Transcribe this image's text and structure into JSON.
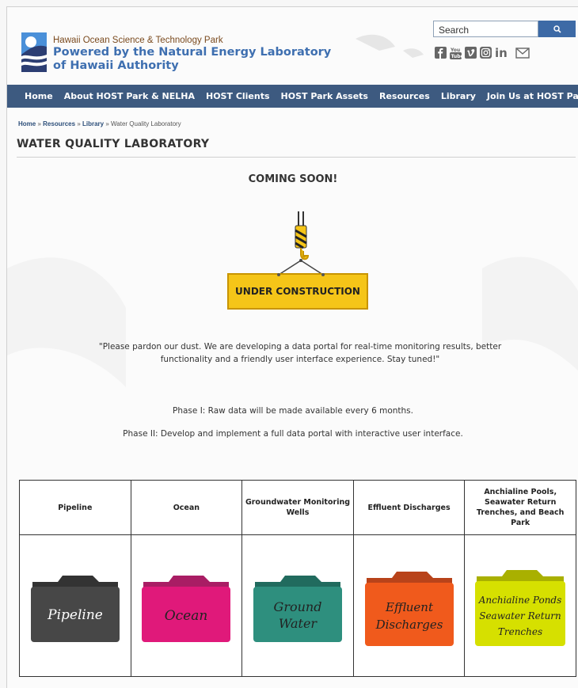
{
  "header": {
    "org_line1": "Hawaii Ocean Science & Technology Park",
    "org_line2": "Powered by the Natural Energy Laboratory of Hawaii Authority",
    "search_placeholder": "Search",
    "social_icons": [
      "facebook-icon",
      "youtube-icon",
      "vimeo-icon",
      "instagram-icon",
      "linkedin-icon",
      "mail-icon"
    ]
  },
  "nav": {
    "items": [
      "Home",
      "About HOST Park & NELHA",
      "HOST Clients",
      "HOST Park Assets",
      "Resources",
      "Library",
      "Join Us at HOST Park"
    ]
  },
  "breadcrumb": {
    "home": "Home",
    "resources": "Resources",
    "library": "Library",
    "current": "Water Quality Laboratory",
    "sep": "»"
  },
  "page_title": "WATER QUALITY LABORATORY",
  "content": {
    "coming_soon": "COMING SOON!",
    "sign_label": "UNDER CONSTRUCTION",
    "quote": "\"Please pardon our dust. We are developing a data portal for real-time monitoring results, better functionality and a friendly user interface experience.  Stay tuned!\"",
    "phase1": "Phase I: Raw data will be made available every 6 months.",
    "phase2": "Phase II: Develop and implement a full data portal with interactive user interface."
  },
  "table": {
    "headers": [
      "Pipeline",
      "Ocean",
      "Groundwater Monitoring Wells",
      "Effluent Discharges",
      "Anchialine Pools, Seawater Return Trenches, and Beach Park"
    ],
    "folders": [
      {
        "label_lines": [
          "Pipeline"
        ],
        "color": "#474747",
        "tab_color": "#333333"
      },
      {
        "label_lines": [
          "Ocean"
        ],
        "color": "#e0197a",
        "tab_color": "#a91d64"
      },
      {
        "label_lines": [
          "Ground",
          "Water"
        ],
        "color": "#2e8f7e",
        "tab_color": "#216b5e"
      },
      {
        "label_lines": [
          "Effluent",
          "Discharges"
        ],
        "color": "#f05a1c",
        "tab_color": "#b8431a"
      },
      {
        "label_lines": [
          "Anchialine Ponds",
          "Seawater Return",
          "Trenches"
        ],
        "color": "#d6e000",
        "tab_color": "#a9b000"
      }
    ]
  },
  "colors": {
    "nav_bg": "#3d5a80",
    "brand_blue": "#3e6fb0",
    "sign_yellow": "#f5c518"
  }
}
